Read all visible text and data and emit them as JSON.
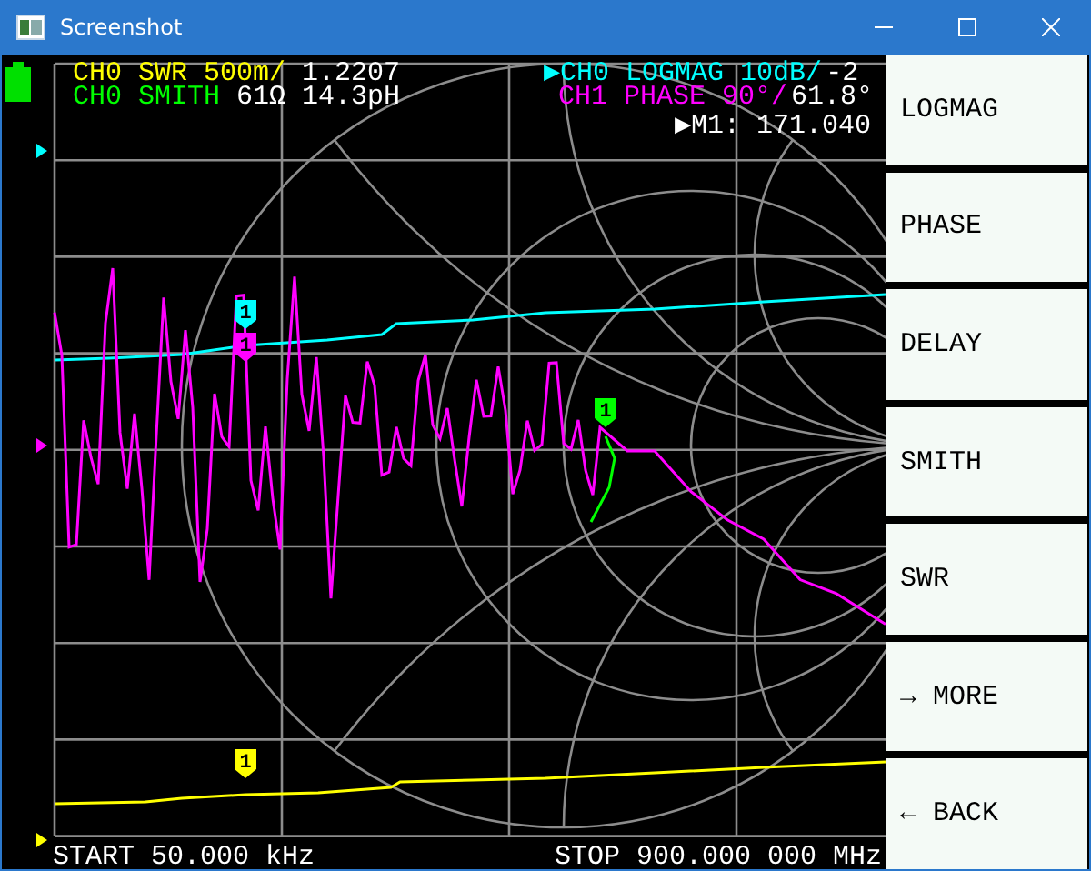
{
  "window": {
    "title": "Screenshot"
  },
  "header_left": [
    {
      "kind": "swr",
      "label": "CH0 SWR 500m/",
      "value": "1.2207",
      "color": "#ffff00",
      "marker": "1"
    },
    {
      "kind": "smith",
      "label": "CH0 SMITH",
      "value": "61Ω 14.3pH",
      "color": "#00ff00",
      "marker": "1"
    }
  ],
  "header_right": [
    {
      "kind": "logmag",
      "prefix": "▶",
      "label": "CH0 LOGMAG 10dB/",
      "value": "-2",
      "color": "#00ffff",
      "marker": "1"
    },
    {
      "kind": "phase",
      "label": "CH1 PHASE 90°/",
      "value": "61.8°",
      "color": "#ff00ff",
      "marker": "1"
    }
  ],
  "marker_reading": "▶M1: 171.040",
  "sweep": {
    "start": "START 50.000 kHz",
    "stop": "STOP 900.000 000 MHz"
  },
  "menu": [
    {
      "label": "LOGMAG"
    },
    {
      "label": "PHASE"
    },
    {
      "label": "DELAY"
    },
    {
      "label": "SMITH"
    },
    {
      "label": "SWR"
    },
    {
      "label": "→ MORE"
    },
    {
      "label": "← BACK"
    }
  ]
}
